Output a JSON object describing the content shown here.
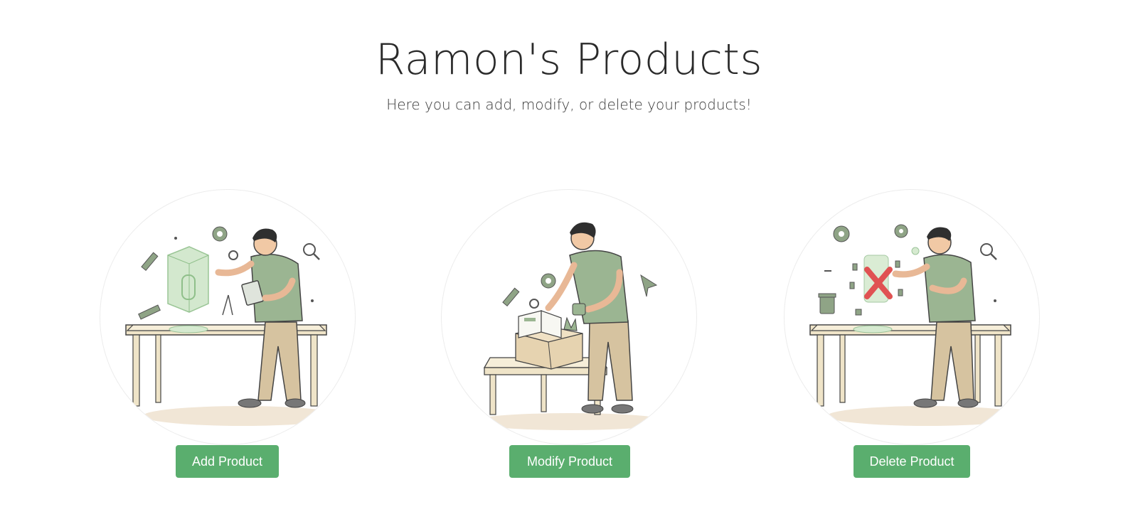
{
  "header": {
    "title": "Ramon's Products",
    "subtitle": "Here you can add, modify, or delete your products!"
  },
  "cards": [
    {
      "illustration": "person-adding-product-illustration",
      "button_label": "Add Product"
    },
    {
      "illustration": "person-modifying-product-illustration",
      "button_label": "Modify Product"
    },
    {
      "illustration": "person-deleting-product-illustration",
      "button_label": "Delete Product"
    }
  ],
  "colors": {
    "button": "#5aae6e",
    "button_text": "#ffffff",
    "shirt": "#9bb592",
    "pants": "#d6c3a0",
    "table": "#efe4c8",
    "delete_mark": "#e05252"
  }
}
